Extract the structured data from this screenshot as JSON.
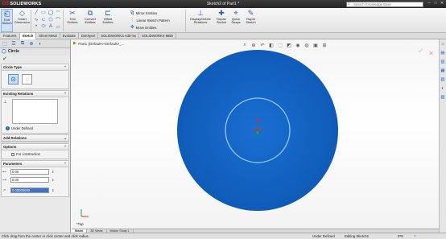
{
  "app": {
    "brand": "SOLIDWORKS",
    "brand_mark": "DS",
    "document_title": "Sketch2 of Part1 *"
  },
  "search": {
    "placeholder": "Search Knowledge Base"
  },
  "ribbon": {
    "exit_sketch": "Exit Sketch",
    "smart_dimension": "Smart Dimension",
    "trim_entities": "Trim Entities",
    "convert_entities": "Convert Entities",
    "offset_entities": "Offset Entities",
    "mirror_entities": "Mirror Entities",
    "linear_sketch_pattern": "Linear Sketch Pattern",
    "move_entities": "Move Entities",
    "display_delete_relations": "Display/Delete Relations",
    "repair_sketch": "Repair Sketch",
    "quick_snaps": "Quick Snaps",
    "rapid_sketch": "Rapid Sketch"
  },
  "tabs": [
    "Features",
    "Sketch",
    "Sheet Metal",
    "Evaluate",
    "DimXpert",
    "SOLIDWORKS Add-Ins",
    "SOLIDWORKS MBD"
  ],
  "active_tab": "Sketch",
  "property_manager": {
    "title": "Circle",
    "circle_type_label": "Circle Type",
    "existing_relations_label": "Existing Relations",
    "under_defined": "Under Defined",
    "add_relations_label": "Add Relations",
    "options_label": "Options",
    "for_construction": "For construction",
    "parameters_label": "Parameters",
    "param_x": "0.00",
    "param_y": "0.00",
    "param_radius": "0.00000000"
  },
  "breadcrumb": "Part1 (Default<<Default>_...",
  "view_label": "*Top",
  "model_tabs": [
    "Model",
    "3D Views",
    "Motion Study 1"
  ],
  "status": {
    "message": "Click drag from the center or click center and click radius.",
    "definition": "Under Defined",
    "editing": "Editing Sketch2",
    "units": "IPS",
    "help": "?"
  },
  "colors": {
    "circle_fill": "#1565C0",
    "inner_circle_stroke": "#8ec9ff",
    "origin": "#d32f2f",
    "center_point": "#2e9e4f"
  }
}
